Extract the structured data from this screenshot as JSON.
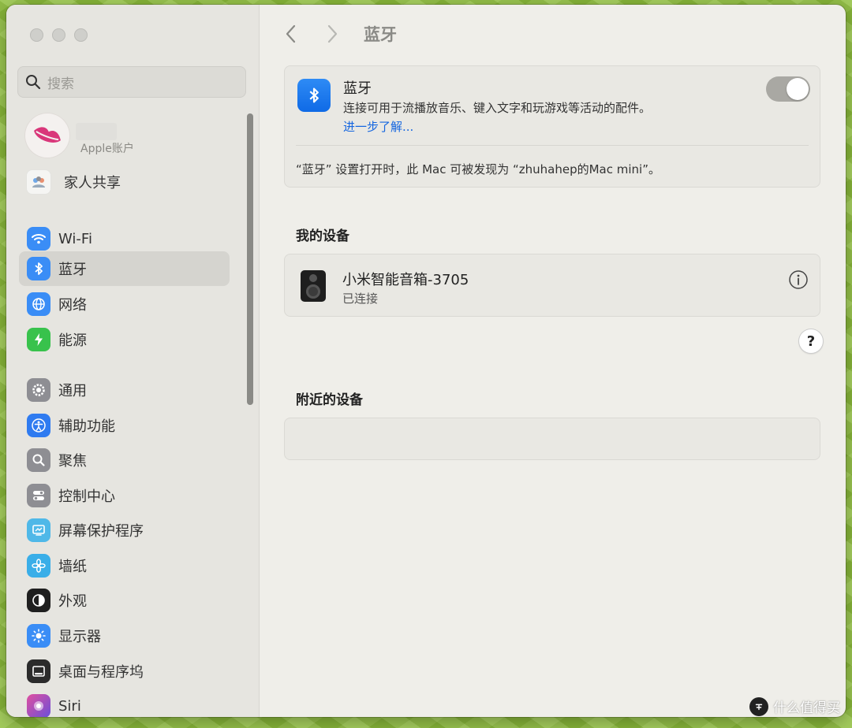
{
  "sidebar": {
    "search_placeholder": "搜索",
    "account_label": "Apple账户",
    "family_label": "家人共享",
    "items": [
      {
        "label": "Wi-Fi",
        "icon": "wifi-icon",
        "color": "#3a8df6"
      },
      {
        "label": "蓝牙",
        "icon": "bluetooth-icon",
        "color": "#3a8df6",
        "selected": true
      },
      {
        "label": "网络",
        "icon": "globe-icon",
        "color": "#3a8df6"
      },
      {
        "label": "能源",
        "icon": "bolt-icon",
        "color": "#38c24c"
      },
      {
        "label": "通用",
        "icon": "gear-icon",
        "color": "#8e8e93"
      },
      {
        "label": "辅助功能",
        "icon": "accessibility-icon",
        "color": "#2f7bf0"
      },
      {
        "label": "聚焦",
        "icon": "magnifier-icon",
        "color": "#8e8e93"
      },
      {
        "label": "控制中心",
        "icon": "control-center-icon",
        "color": "#8e8e93"
      },
      {
        "label": "屏幕保护程序",
        "icon": "screensaver-icon",
        "color": "#4fb8e8"
      },
      {
        "label": "墙纸",
        "icon": "flower-icon",
        "color": "#3aaee8"
      },
      {
        "label": "外观",
        "icon": "appearance-icon",
        "color": "#1f1f1f"
      },
      {
        "label": "显示器",
        "icon": "sun-icon",
        "color": "#3a8df6"
      },
      {
        "label": "桌面与程序坞",
        "icon": "dock-icon",
        "color": "#2b2b2b"
      },
      {
        "label": "Siri",
        "icon": "siri-icon",
        "color": "#b04fd8"
      }
    ]
  },
  "main": {
    "title": "蓝牙",
    "bluetooth": {
      "title": "蓝牙",
      "description": "连接可用于流播放音乐、键入文字和玩游戏等活动的配件。",
      "link": "进一步了解...",
      "enabled": true,
      "footer": "“蓝牙” 设置打开时，此 Mac 可被发现为 “zhuhahep的Mac mini”。"
    },
    "my_devices_heading": "我的设备",
    "devices": [
      {
        "name": "小米智能音箱-3705",
        "status": "已连接",
        "icon": "speaker-icon"
      }
    ],
    "help_label": "?",
    "nearby_heading": "附近的设备"
  },
  "watermark": "什么值得买",
  "colors": {
    "accent": "#1566e0",
    "selected_bg": "#d5d4cf"
  }
}
